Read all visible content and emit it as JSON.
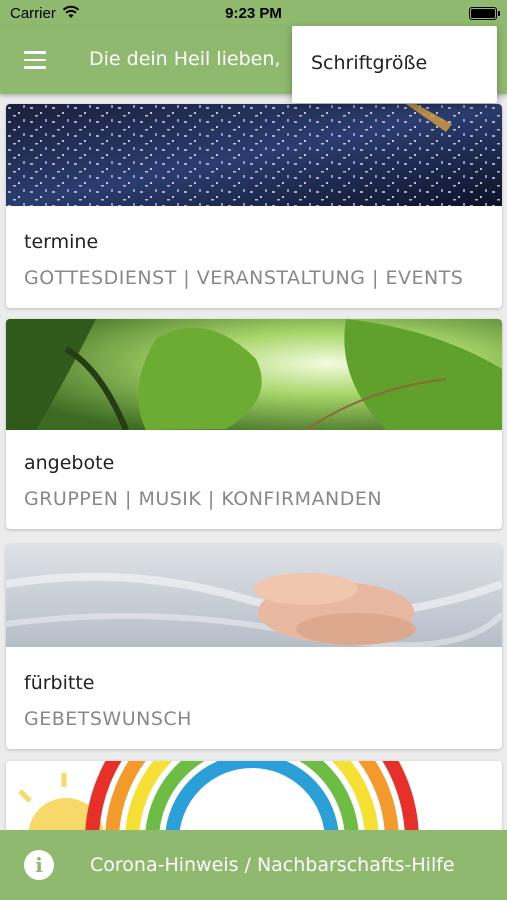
{
  "status_bar": {
    "carrier": "Carrier",
    "time": "9:23 PM"
  },
  "app_bar": {
    "title": "Die dein Heil lieben,"
  },
  "overflow_menu": {
    "items": [
      {
        "label": "Schriftgröße"
      }
    ]
  },
  "cards": [
    {
      "title": "termine",
      "subtitle": "GOTTESDIENST | VERANSTALTUNG | EVENTS",
      "image": "confetti-concert-photo"
    },
    {
      "title": "angebote",
      "subtitle": "GRUPPEN | MUSIK | KONFIRMANDEN",
      "image": "green-leaves-photo"
    },
    {
      "title": "fürbitte",
      "subtitle": "GEBETSWUNSCH",
      "image": "praying-hands-photo"
    },
    {
      "title": "",
      "subtitle": "",
      "image": "rainbow-sun-illustration"
    }
  ],
  "bottom_bar": {
    "label": "Corona-Hinweis / Nachbarschafts-Hilfe",
    "icon": "info-icon"
  },
  "colors": {
    "accent": "#8fb96f",
    "card_bg": "#ffffff",
    "subtitle": "#888888"
  }
}
